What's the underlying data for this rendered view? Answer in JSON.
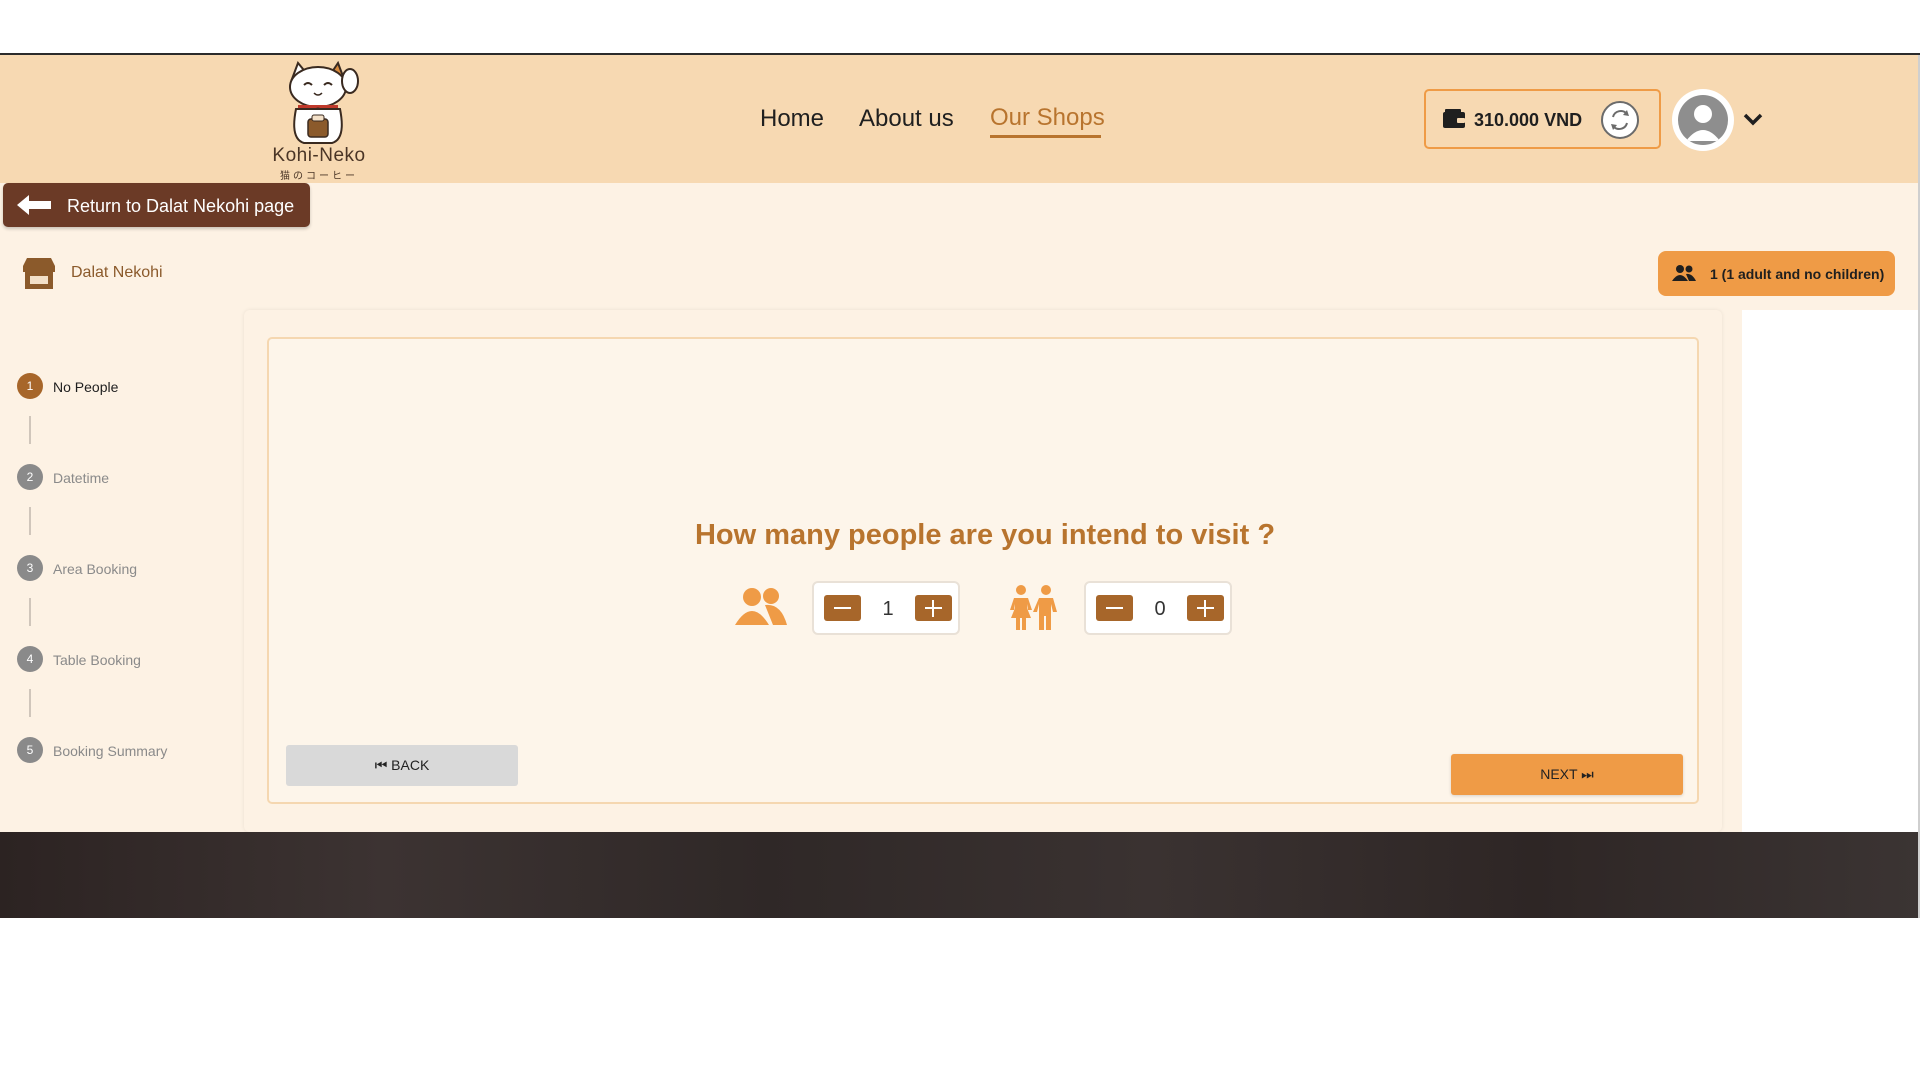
{
  "brand": {
    "name": "Kohi-Neko",
    "subtitle": "猫のコーヒー"
  },
  "nav": {
    "items": [
      {
        "label": "Home"
      },
      {
        "label": "About us"
      },
      {
        "label": "Our Shops"
      }
    ],
    "active": "Our Shops"
  },
  "wallet": {
    "balance": "310.000 VND"
  },
  "return_button": {
    "label": "Return to Dalat Nekohi page"
  },
  "shop": {
    "name": "Dalat Nekohi"
  },
  "people_badge": {
    "label": "1 (1 adult and no children)"
  },
  "steps": [
    {
      "number": "1",
      "label": "No People",
      "active": true
    },
    {
      "number": "2",
      "label": "Datetime",
      "active": false
    },
    {
      "number": "3",
      "label": "Area Booking",
      "active": false
    },
    {
      "number": "4",
      "label": "Table Booking",
      "active": false
    },
    {
      "number": "5",
      "label": "Booking Summary",
      "active": false
    }
  ],
  "booking": {
    "question": "How many people are you intend to visit ?",
    "adults": 1,
    "children": 0,
    "back_label": "⏮ BACK",
    "next_label": "NEXT ⏭"
  },
  "colors": {
    "header_bg": "#f7d9b2",
    "accent": "#ef9b46",
    "brown": "#a7662a",
    "dark_brown": "#6b3a26",
    "title": "#b8742e"
  }
}
